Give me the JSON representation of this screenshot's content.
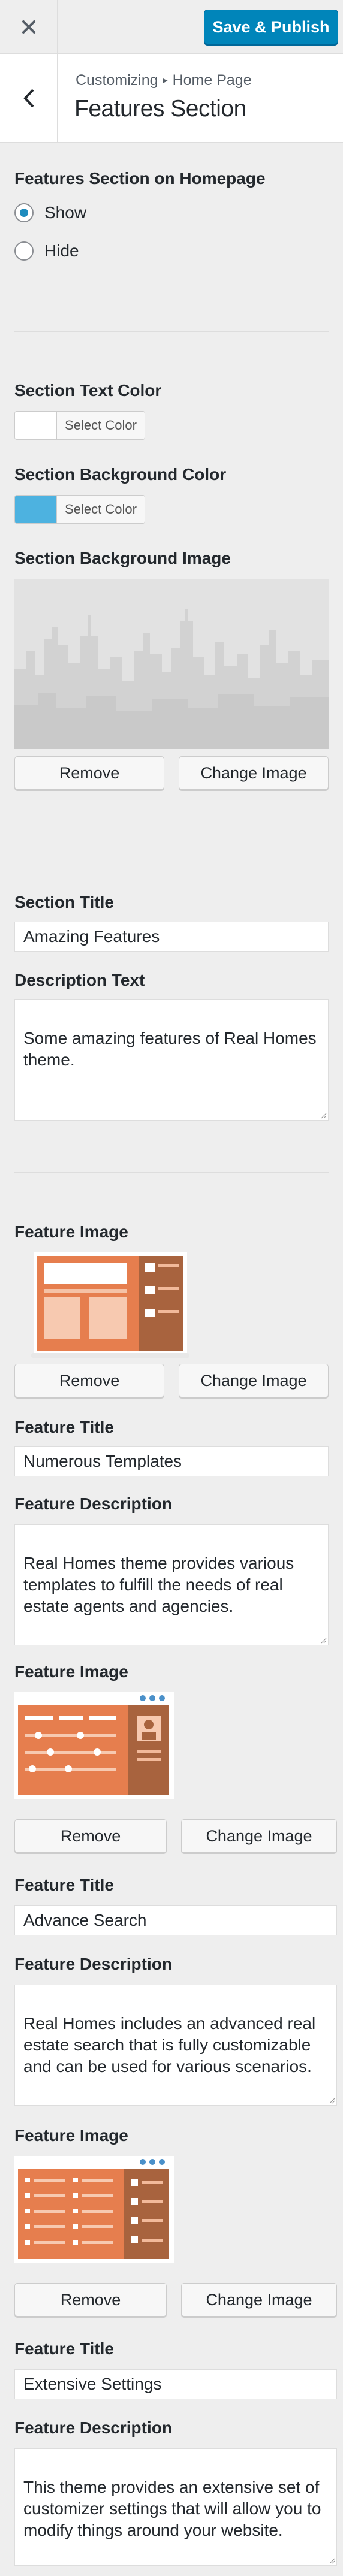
{
  "top_bar": {
    "close_icon": "close-icon",
    "save_label": "Save & Publish",
    "save_color": "#0085ba"
  },
  "header": {
    "back_icon": "chevron-left-icon",
    "breadcrumb_parent": "Customizing",
    "breadcrumb_separator_icon": "triangle-right-icon",
    "breadcrumb_current": "Home Page",
    "title": "Features Section"
  },
  "display": {
    "label": "Features Section on Homepage",
    "options": [
      "Show",
      "Hide"
    ],
    "selected": "Show"
  },
  "colors": {
    "text_color_label": "Section Text Color",
    "text_color_button": "Select Color",
    "text_color_value": "#ffffff",
    "bg_color_label": "Section Background Color",
    "bg_color_button": "Select Color",
    "bg_color_value": "#4db2e0"
  },
  "bg_image": {
    "label": "Section Background Image",
    "remove_label": "Remove",
    "change_label": "Change Image"
  },
  "section": {
    "title_label": "Section Title",
    "title_value": "Amazing Features",
    "desc_label": "Description Text",
    "desc_value": "Some amazing features of Real Homes theme."
  },
  "features": [
    {
      "image_label": "Feature Image",
      "remove_label": "Remove",
      "change_label": "Change Image",
      "title_label": "Feature Title",
      "title_value": "Numerous Templates",
      "desc_label": "Feature Description",
      "desc_value": "Real Homes theme provides various templates to fulfill the needs of real estate agents and agencies."
    },
    {
      "image_label": "Feature Image",
      "remove_label": "Remove",
      "change_label": "Change Image",
      "title_label": "Feature Title",
      "title_value": "Advance Search",
      "desc_label": "Feature Description",
      "desc_value": "Real Homes includes an advanced real estate search that is fully customizable and can be used for various scenarios."
    },
    {
      "image_label": "Feature Image",
      "remove_label": "Remove",
      "change_label": "Change Image",
      "title_label": "Feature Title",
      "title_value": "Extensive Settings",
      "desc_label": "Feature Description",
      "desc_value": "This theme provides an extensive set of customizer settings that will allow you to modify things around your website."
    }
  ]
}
